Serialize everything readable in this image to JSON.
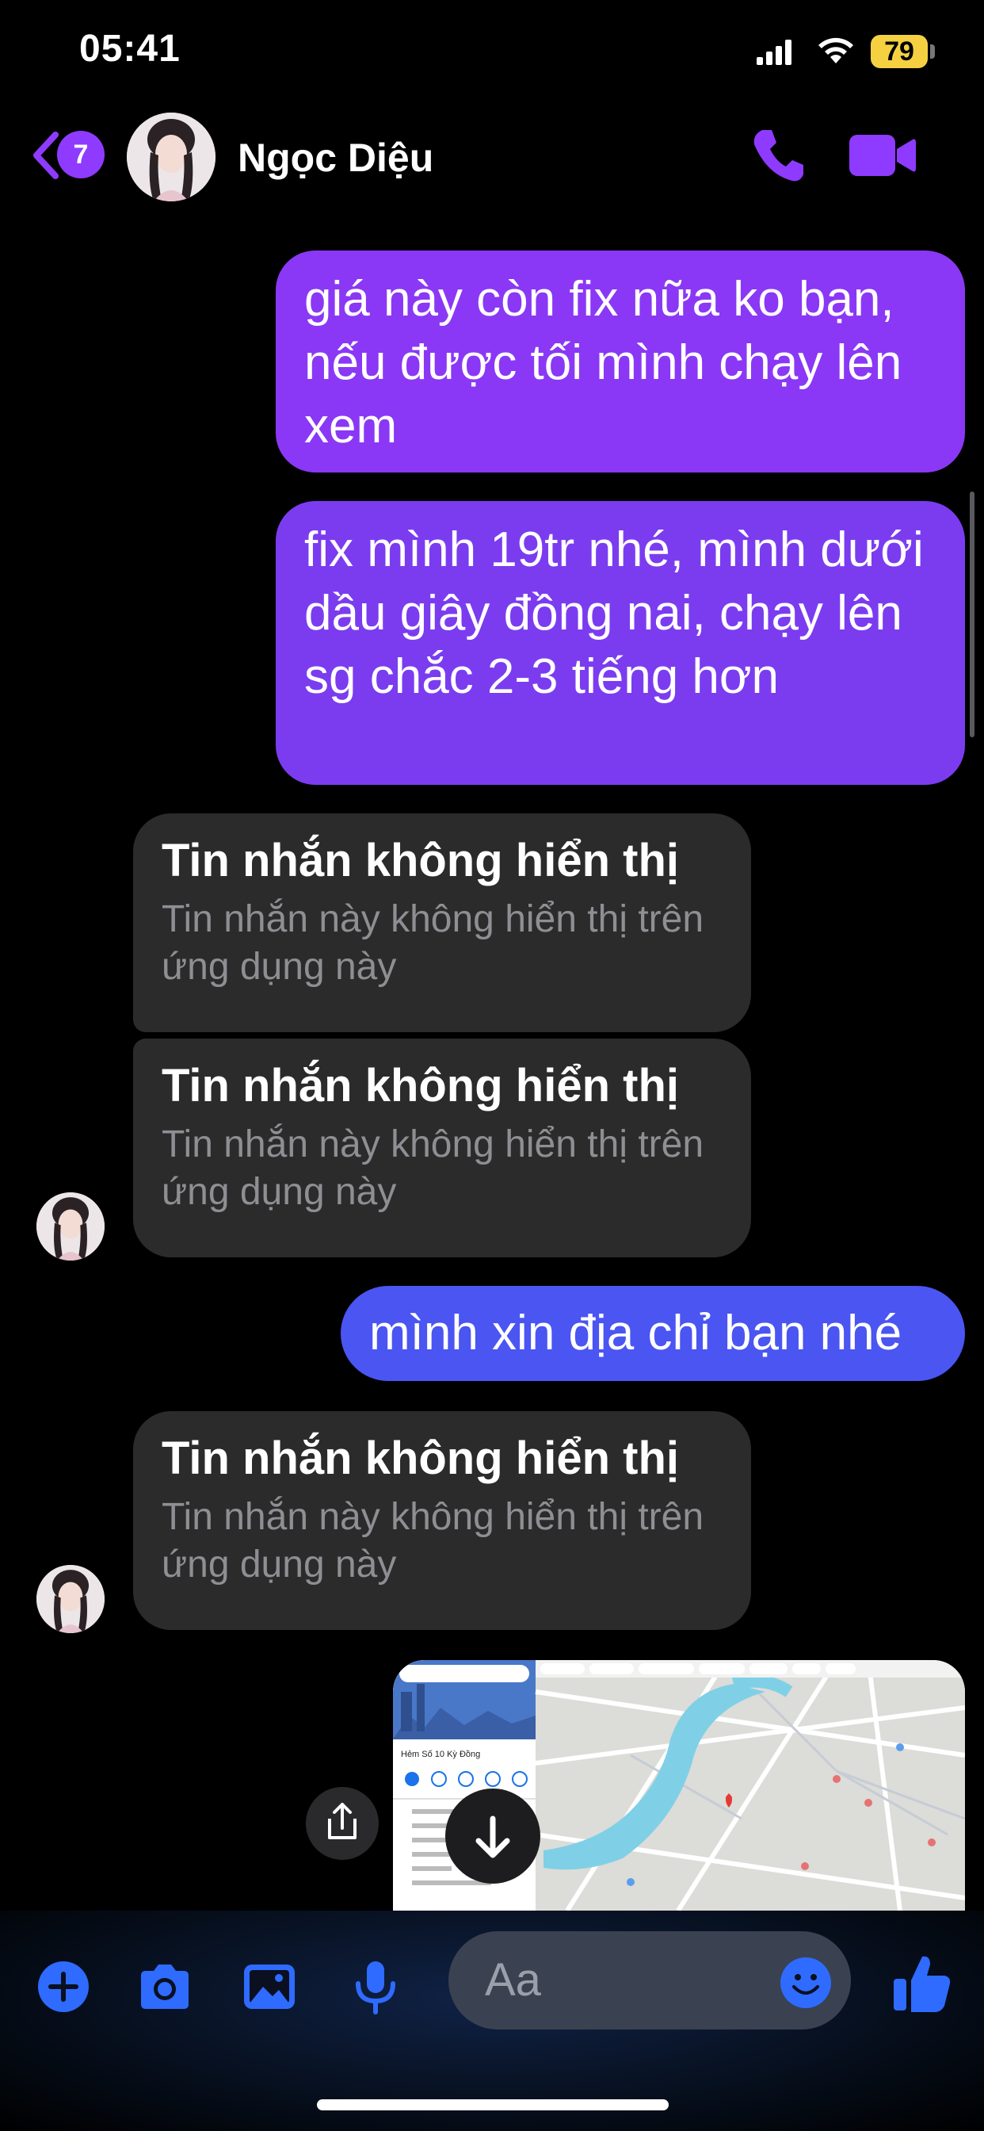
{
  "status_bar": {
    "time": "05:41",
    "battery": "79"
  },
  "header": {
    "back_badge_count": "7",
    "contact_name": "Ngọc Diệu"
  },
  "messages": {
    "sent_1": "giá này còn fix nữa ko bạn, nếu được tối mình chạy lên xem",
    "sent_2": "fix mình 19tr nhé, mình dưới dầu giây đồng nai, chạy lên sg chắc 2-3 tiếng hơn",
    "sent_3": "mình xin địa chỉ bạn nhé",
    "hidden_title": "Tin nhắn không hiển thị",
    "hidden_body": "Tin nhắn này không hiển thị trên ứng dụng này"
  },
  "map": {
    "place_title": "Hẻm Số 10 Kỳ Đồng",
    "search_text": "Hẻm Số 10 Kỳ Đồng"
  },
  "composer": {
    "placeholder": "Aa"
  },
  "colors": {
    "accent": "#8e3bff",
    "sent_bubble_top": "#8a38f5",
    "sent_bubble_bottom": "#4a55f2",
    "received_bubble": "#2b2b2c",
    "composer_icons": "#2f6bff"
  }
}
